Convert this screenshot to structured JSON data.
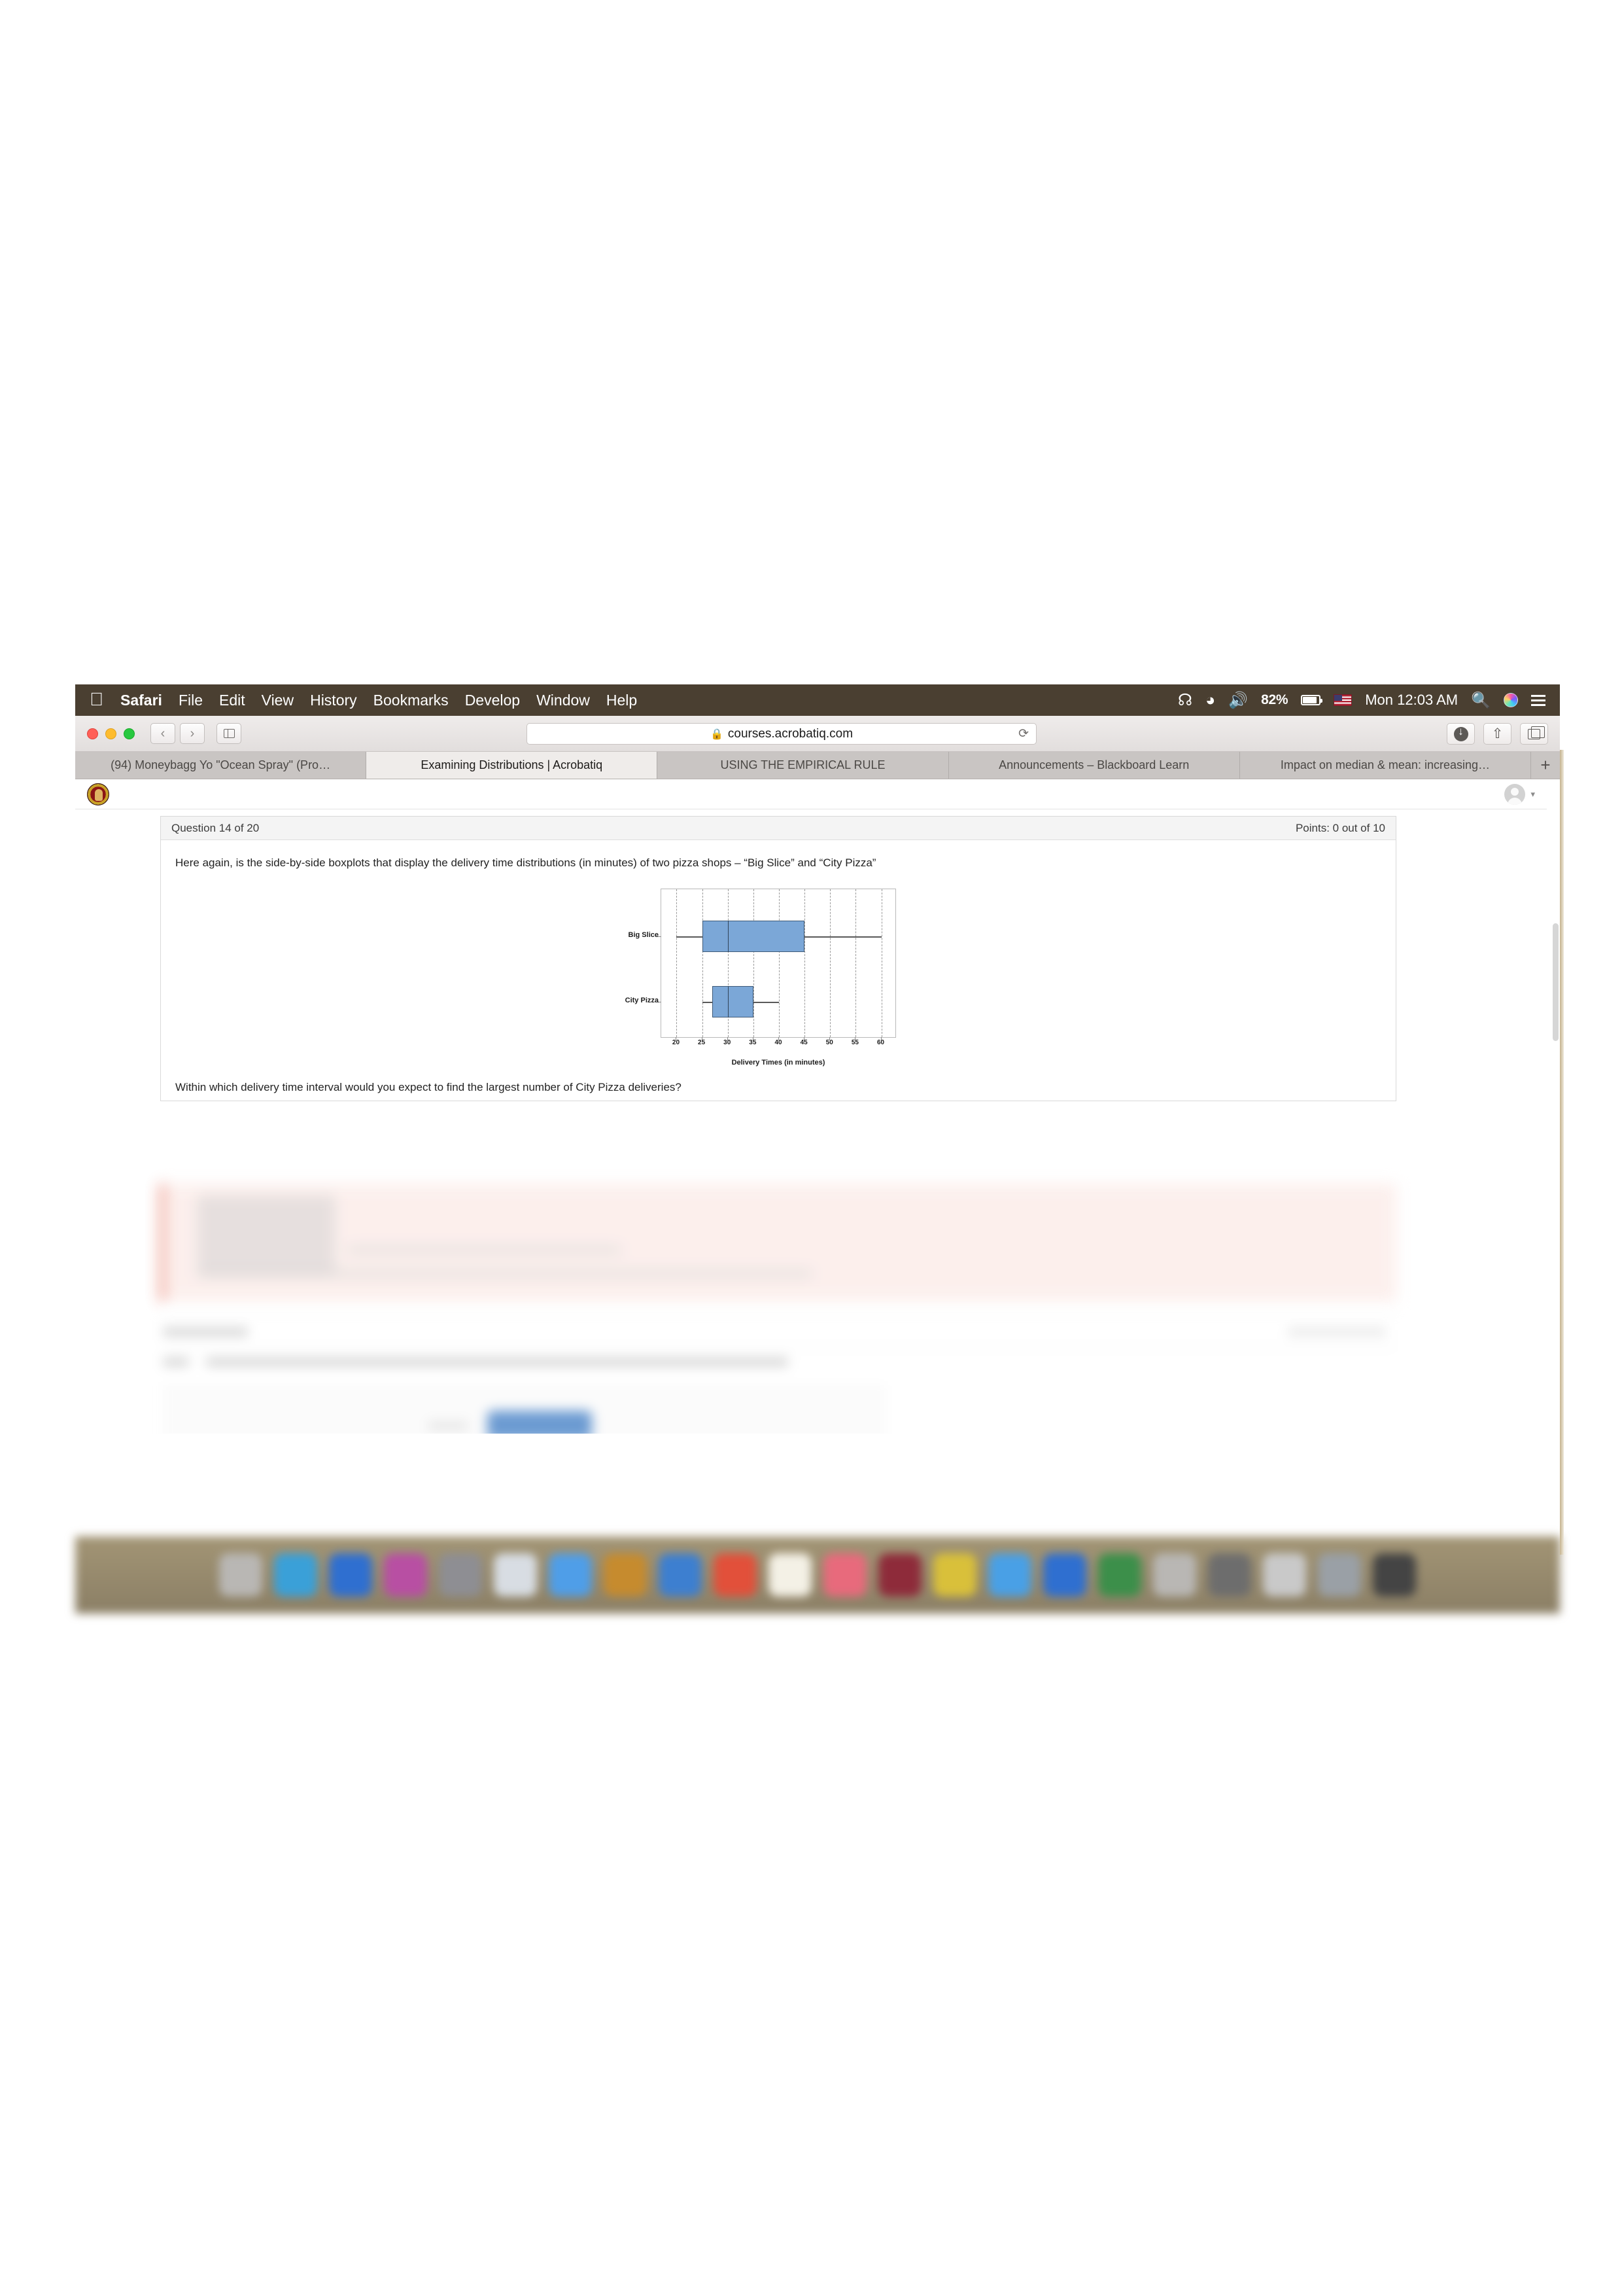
{
  "menubar": {
    "apple_icon": "apple-logo-icon",
    "items": [
      {
        "label": "Safari",
        "bold": true
      },
      {
        "label": "File",
        "bold": false
      },
      {
        "label": "Edit",
        "bold": false
      },
      {
        "label": "View",
        "bold": false
      },
      {
        "label": "History",
        "bold": false
      },
      {
        "label": "Bookmarks",
        "bold": false
      },
      {
        "label": "Develop",
        "bold": false
      },
      {
        "label": "Window",
        "bold": false
      },
      {
        "label": "Help",
        "bold": false
      }
    ],
    "status": {
      "bluetooth_icon": "bluetooth-icon",
      "wifi_icon": "wifi-icon",
      "volume_icon": "volume-icon",
      "battery_percent": "82%",
      "input_flag": "us-flag-icon",
      "clock": "Mon 12:03 AM",
      "spotlight_icon": "search-icon",
      "siri_icon": "siri-icon",
      "notification_icon": "notification-center-icon"
    }
  },
  "toolbar": {
    "back_label": "‹",
    "forward_label": "›",
    "sidebar_icon": "sidebar-icon",
    "url": "courses.acrobatiq.com",
    "lock_icon": "lock-icon",
    "reload_label": "⟳",
    "downloads_icon": "downloads-icon",
    "share_icon": "share-icon",
    "tab_overview_icon": "tab-overview-icon"
  },
  "tabs": [
    {
      "title": "(94) Moneybagg Yo \"Ocean Spray\" (Pro…",
      "active": false
    },
    {
      "title": "Examining Distributions | Acrobatiq",
      "active": true
    },
    {
      "title": "USING THE EMPIRICAL RULE",
      "active": false
    },
    {
      "title": "Announcements – Blackboard Learn",
      "active": false
    },
    {
      "title": "Impact on median & mean: increasing…",
      "active": false
    }
  ],
  "tab_new_label": "+",
  "page": {
    "logo_icon": "university-seal-icon",
    "account_avatar_icon": "user-avatar-icon",
    "account_caret_icon": "chevron-down-icon",
    "quiz": {
      "question_counter": "Question 14 of 20",
      "points": "Points: 0 out of 10",
      "prompt": "Here again, is the side-by-side boxplots that display the delivery time distributions (in minutes) of two pizza shops – “Big Slice” and “City Pizza”",
      "sub_question": "Within which delivery time interval would you expect to find the largest number of City Pizza deliveries?"
    }
  },
  "chart_data": {
    "type": "box",
    "title": "",
    "xlabel": "Delivery Times (in minutes)",
    "ylabel": "",
    "xlim": [
      17,
      63
    ],
    "xticks": [
      20,
      25,
      30,
      35,
      40,
      45,
      50,
      55,
      60
    ],
    "xticklabels": [
      "20",
      "25",
      "30",
      "35",
      "40",
      "45",
      "50",
      "55",
      "60"
    ],
    "grid": true,
    "grid_style": "dashed-vertical",
    "legend": "none",
    "categories": [
      "Big Slice",
      "City Pizza"
    ],
    "box_color": "#7ba7d7",
    "line_color": "#4a4a4a",
    "series": [
      {
        "name": "Big Slice",
        "min": 20,
        "q1": 25,
        "median": 30,
        "q3": 45,
        "max": 60
      },
      {
        "name": "City Pizza",
        "min": 25,
        "q1": 27,
        "median": 30,
        "q3": 35,
        "max": 40
      }
    ]
  }
}
